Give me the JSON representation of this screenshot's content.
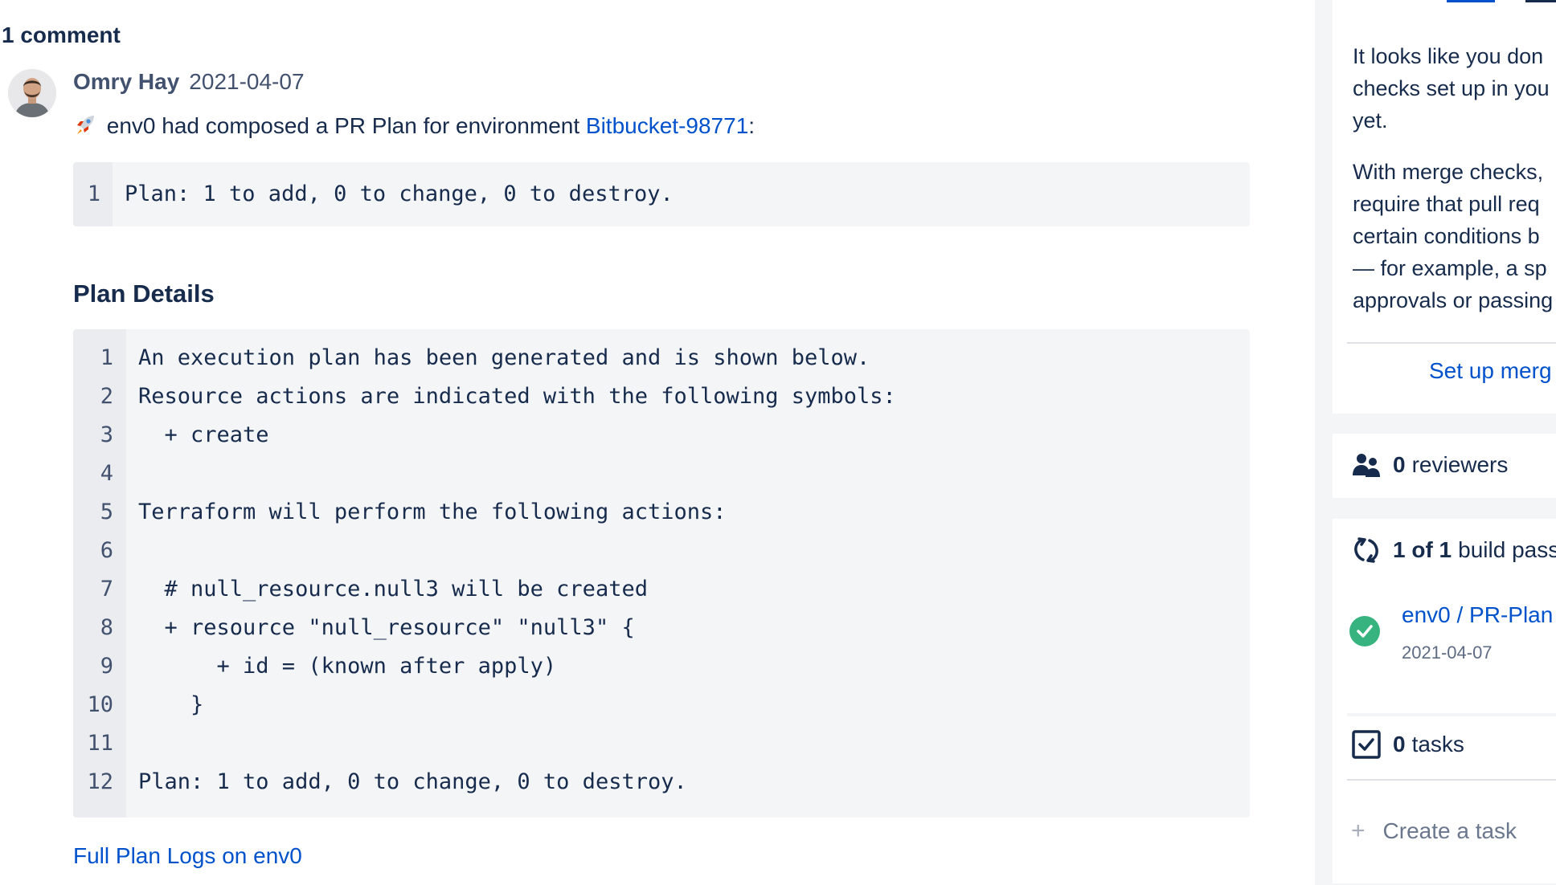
{
  "comments": {
    "count_label": "1 comment",
    "author": "Omry Hay",
    "date": "2021-04-07",
    "body_prefix": "env0 had composed a PR Plan for environment",
    "environment_link": "Bitbucket-98771",
    "body_suffix": ":",
    "summary_code": [
      {
        "n": "1",
        "text": "Plan: 1 to add, 0 to change, 0 to destroy."
      }
    ],
    "plan_details_title": "Plan Details",
    "plan_code": [
      {
        "n": "1",
        "text": "An execution plan has been generated and is shown below."
      },
      {
        "n": "2",
        "text": "Resource actions are indicated with the following symbols:"
      },
      {
        "n": "3",
        "text": "  + create"
      },
      {
        "n": "4",
        "text": ""
      },
      {
        "n": "5",
        "text": "Terraform will perform the following actions:"
      },
      {
        "n": "6",
        "text": ""
      },
      {
        "n": "7",
        "text": "  # null_resource.null3 will be created"
      },
      {
        "n": "8",
        "text": "  + resource \"null_resource\" \"null3\" {"
      },
      {
        "n": "9",
        "text": "      + id = (known after apply)"
      },
      {
        "n": "10",
        "text": "    }"
      },
      {
        "n": "11",
        "text": ""
      },
      {
        "n": "12",
        "text": "Plan: 1 to add, 0 to change, 0 to destroy."
      }
    ],
    "full_logs_link": "Full Plan Logs on env0"
  },
  "sidebar": {
    "merge_checks_text": [
      "It looks like you don",
      "checks set up in you",
      "yet."
    ],
    "merge_checks_text2": [
      "With merge checks,",
      "require that pull req",
      "certain conditions b",
      "— for example, a sp",
      "approvals or passing"
    ],
    "setup_link": "Set up merg",
    "reviewers_count": "0",
    "reviewers_label": "reviewers",
    "builds_count": "1 of 1",
    "builds_label": "build pass",
    "build_name": "env0 / PR-Plan",
    "build_date": "2021-04-07",
    "tasks_count": "0",
    "tasks_label": "tasks",
    "create_task": "Create a task"
  },
  "colors": {
    "link": "#0052CC",
    "success": "#36B37E",
    "text": "#172B4D"
  },
  "icons": [
    "rocket-icon",
    "people-icon",
    "refresh-icon",
    "check-circle-icon",
    "checkbox-icon",
    "plus-icon"
  ]
}
